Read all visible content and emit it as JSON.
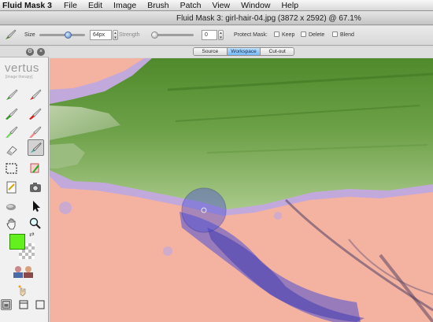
{
  "menubar": {
    "app_name": "Fluid Mask 3",
    "items": [
      "File",
      "Edit",
      "Image",
      "Brush",
      "Patch",
      "View",
      "Window",
      "Help"
    ]
  },
  "window": {
    "title": "Fluid Mask 3: girl-hair-04.jpg (3872 x 2592) @ 67.1%"
  },
  "options": {
    "size_label": "Size",
    "size_value": "64px",
    "strength_label": "Strength",
    "strength_value": "0",
    "protect_label": "Protect Mask:",
    "keep_label": "Keep",
    "delete_label": "Delete",
    "blend_label": "Blend"
  },
  "view_tabs": [
    {
      "label": "Source",
      "active": false
    },
    {
      "label": "Workspace",
      "active": true
    },
    {
      "label": "Cut-out",
      "active": false
    }
  ],
  "palette": {
    "logo_name": "vertus",
    "logo_tagline": "[image therapy]",
    "foreground_color": "#63f01d"
  },
  "colors": {
    "mask_pink": "#f4b2a0",
    "brush_blue": "#5a5ad8",
    "tab_active": "#76b7f5"
  }
}
